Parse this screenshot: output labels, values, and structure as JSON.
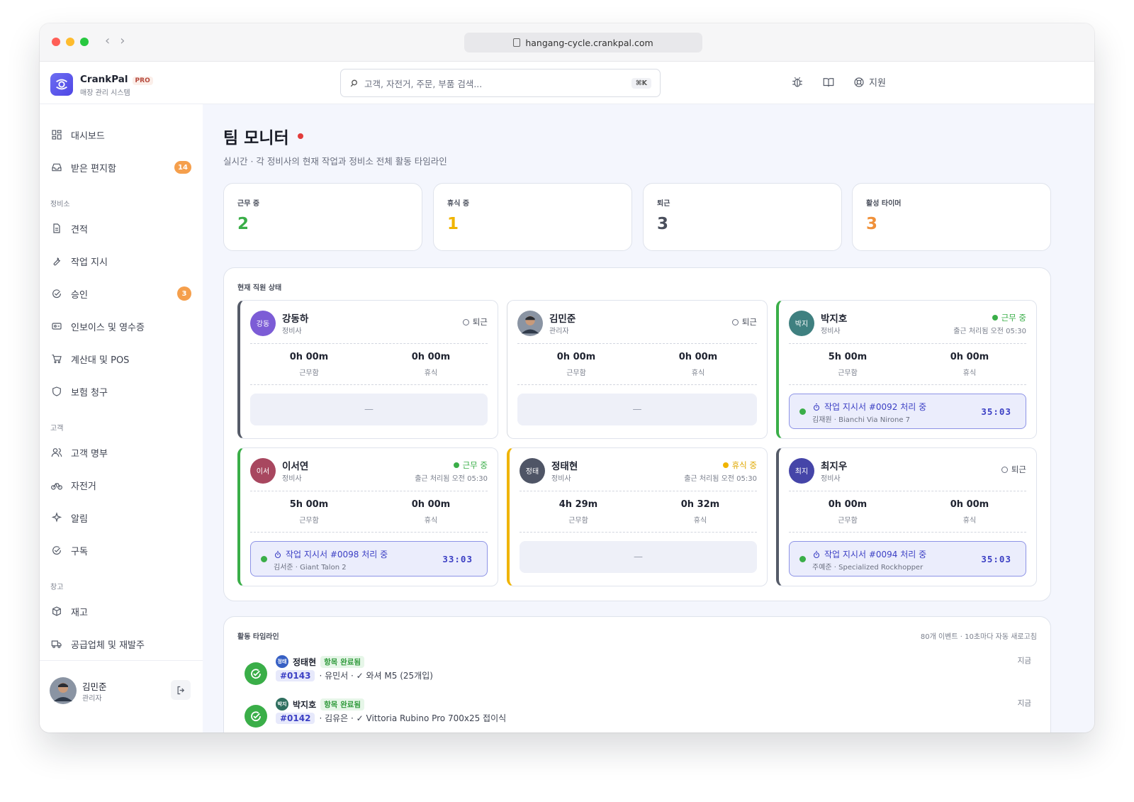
{
  "browser": {
    "url": "hangang-cycle.crankpal.com"
  },
  "brand": {
    "name": "CrankPal",
    "badge": "PRO",
    "subtitle": "매장 관리 시스템"
  },
  "search": {
    "placeholder": "고객, 자전거, 주문, 부품 검색...",
    "shortcut": "⌘K"
  },
  "header": {
    "support_label": "지원"
  },
  "sidebar": {
    "top_items": [
      {
        "label": "대시보드"
      },
      {
        "label": "받은 편지함",
        "badge": "14"
      }
    ],
    "sections": [
      {
        "title": "정비소",
        "items": [
          {
            "label": "견적"
          },
          {
            "label": "작업 지시"
          },
          {
            "label": "승인",
            "badge": "3"
          },
          {
            "label": "인보이스 및 영수증"
          },
          {
            "label": "계산대 및 POS"
          },
          {
            "label": "보험 청구"
          }
        ]
      },
      {
        "title": "고객",
        "items": [
          {
            "label": "고객 명부"
          },
          {
            "label": "자전거"
          },
          {
            "label": "알림"
          },
          {
            "label": "구독"
          }
        ]
      },
      {
        "title": "창고",
        "items": [
          {
            "label": "재고"
          },
          {
            "label": "공급업체 및 재발주"
          }
        ]
      }
    ],
    "user": {
      "name": "김민준",
      "role": "관리자"
    }
  },
  "page": {
    "title": "팀 모니터",
    "subtitle": "실시간 · 각 정비사의 현재 작업과 정비소 전체 활동 타임라인"
  },
  "stats": [
    {
      "label": "근무 중",
      "value": "2",
      "color": "#3aae48"
    },
    {
      "label": "휴식 중",
      "value": "1",
      "color": "#f0b400"
    },
    {
      "label": "퇴근",
      "value": "3",
      "color": "#4a4f5c"
    },
    {
      "label": "활성 타이머",
      "value": "3",
      "color": "#f0913a"
    }
  ],
  "staff_panel": {
    "title": "현재 직원 상태",
    "worked_label": "근무함",
    "break_label": "휴식",
    "empty_placeholder": "—",
    "cards": [
      {
        "initials": "강동",
        "avatar_color": "#7c5cd6",
        "name": "강동하",
        "role": "정비사",
        "status": "퇴근",
        "status_type": "off",
        "worked": "0h 00m",
        "break": "0h 00m"
      },
      {
        "initials": "",
        "avatar_color": "#555b68",
        "name": "김민준",
        "role": "관리자",
        "status": "퇴근",
        "status_type": "off",
        "worked": "0h 00m",
        "break": "0h 00m"
      },
      {
        "initials": "박지",
        "avatar_color": "#3f8080",
        "name": "박지호",
        "role": "정비사",
        "status": "근무 중",
        "status_type": "working",
        "clock_in": "출근 처리됨 오전 05:30",
        "worked": "5h 00m",
        "break": "0h 00m",
        "task": {
          "title": "작업 지시서 #0092 처리 중",
          "sub": "김재원 · Bianchi Via Nirone 7",
          "timer": "35:03"
        }
      },
      {
        "initials": "이서",
        "avatar_color": "#a8475f",
        "name": "이서연",
        "role": "정비사",
        "status": "근무 중",
        "status_type": "working",
        "clock_in": "출근 처리됨 오전 05:30",
        "worked": "5h 00m",
        "break": "0h 00m",
        "task": {
          "title": "작업 지시서 #0098 처리 중",
          "sub": "김서준 · Giant Talon 2",
          "timer": "33:03"
        }
      },
      {
        "initials": "정태",
        "avatar_color": "#4f5566",
        "name": "정태현",
        "role": "정비사",
        "status": "휴식 중",
        "status_type": "break",
        "clock_in": "출근 처리됨 오전 05:30",
        "worked": "4h 29m",
        "break": "0h 32m"
      },
      {
        "initials": "최지",
        "avatar_color": "#4545a8",
        "name": "최지우",
        "role": "정비사",
        "status": "퇴근",
        "status_type": "off",
        "worked": "0h 00m",
        "break": "0h 00m",
        "task": {
          "title": "작업 지시서 #0094 처리 중",
          "sub": "주예준 · Specialized Rockhopper",
          "timer": "35:03"
        }
      }
    ]
  },
  "timeline": {
    "title": "활동 타임라인",
    "meta": "80개 이벤트 · 10초마다 자동 새로고침",
    "items": [
      {
        "mini": "정태",
        "mini_color": "#3760c4",
        "name": "정태현",
        "tag": "항목 완료됨",
        "wo": "#0143",
        "desc": "· 유민서 · ✓ 와셔 M5 (25개입)",
        "time": "지금"
      },
      {
        "mini": "박지",
        "mini_color": "#2e6e5e",
        "name": "박지호",
        "tag": "항목 완료됨",
        "wo": "#0142",
        "desc": "· 김유은 · ✓ Vittoria Rubino Pro 700x25 접이식",
        "time": "지금"
      }
    ]
  }
}
